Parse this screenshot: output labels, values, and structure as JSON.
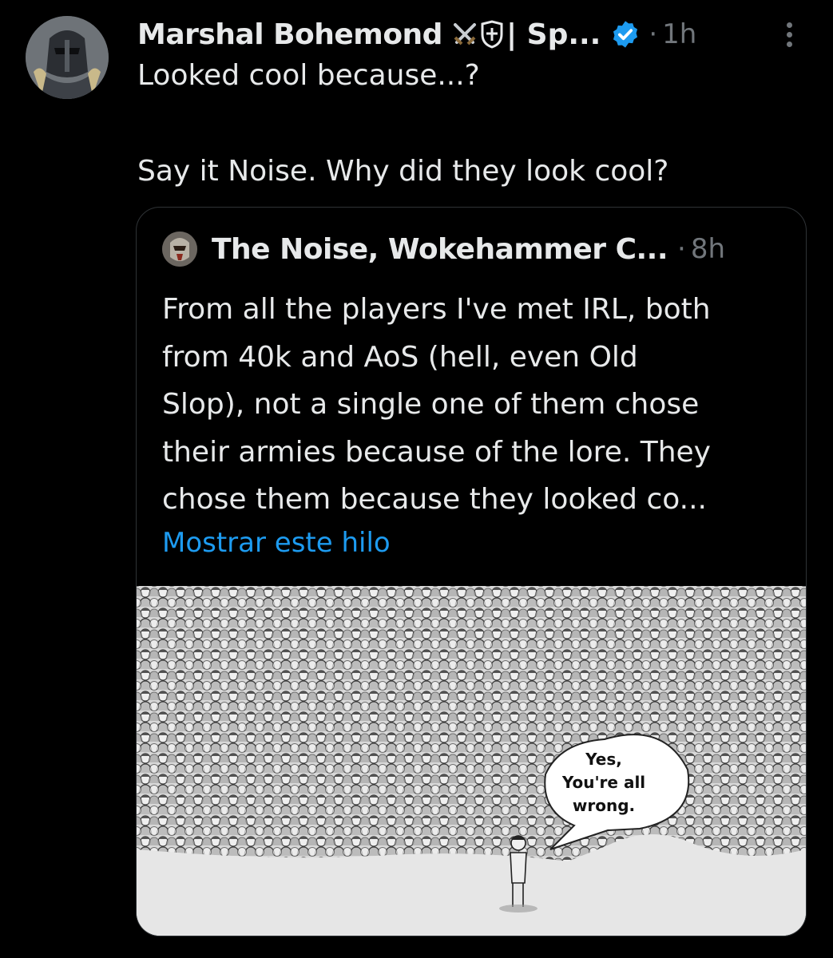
{
  "tweet": {
    "author_name": "Marshal Bohemond",
    "author_name_suffix": "| Sp...",
    "timestamp": "1h",
    "separator": "·",
    "lines": [
      "Looked cool because...?",
      "Say it Noise. Why did they look cool?"
    ],
    "icons": [
      "crossed-swords-icon",
      "shield-icon",
      "verified-badge-icon",
      "more-options-icon"
    ],
    "accent_color": "#1d9bf0"
  },
  "quoted": {
    "author_name": "The Noise, Wokehammer C...",
    "timestamp": "8h",
    "separator": "·",
    "text_lines": [
      "From all the players I've met IRL, both",
      "from 40k and AoS (hell, even Old",
      "Slop), not a single one of them chose",
      "their armies because of the lore. They",
      "chose them because they looked co..."
    ],
    "show_thread": "Mostrar este hilo",
    "meme_bubble_lines": [
      "Yes,",
      "You're all",
      "wrong."
    ]
  }
}
